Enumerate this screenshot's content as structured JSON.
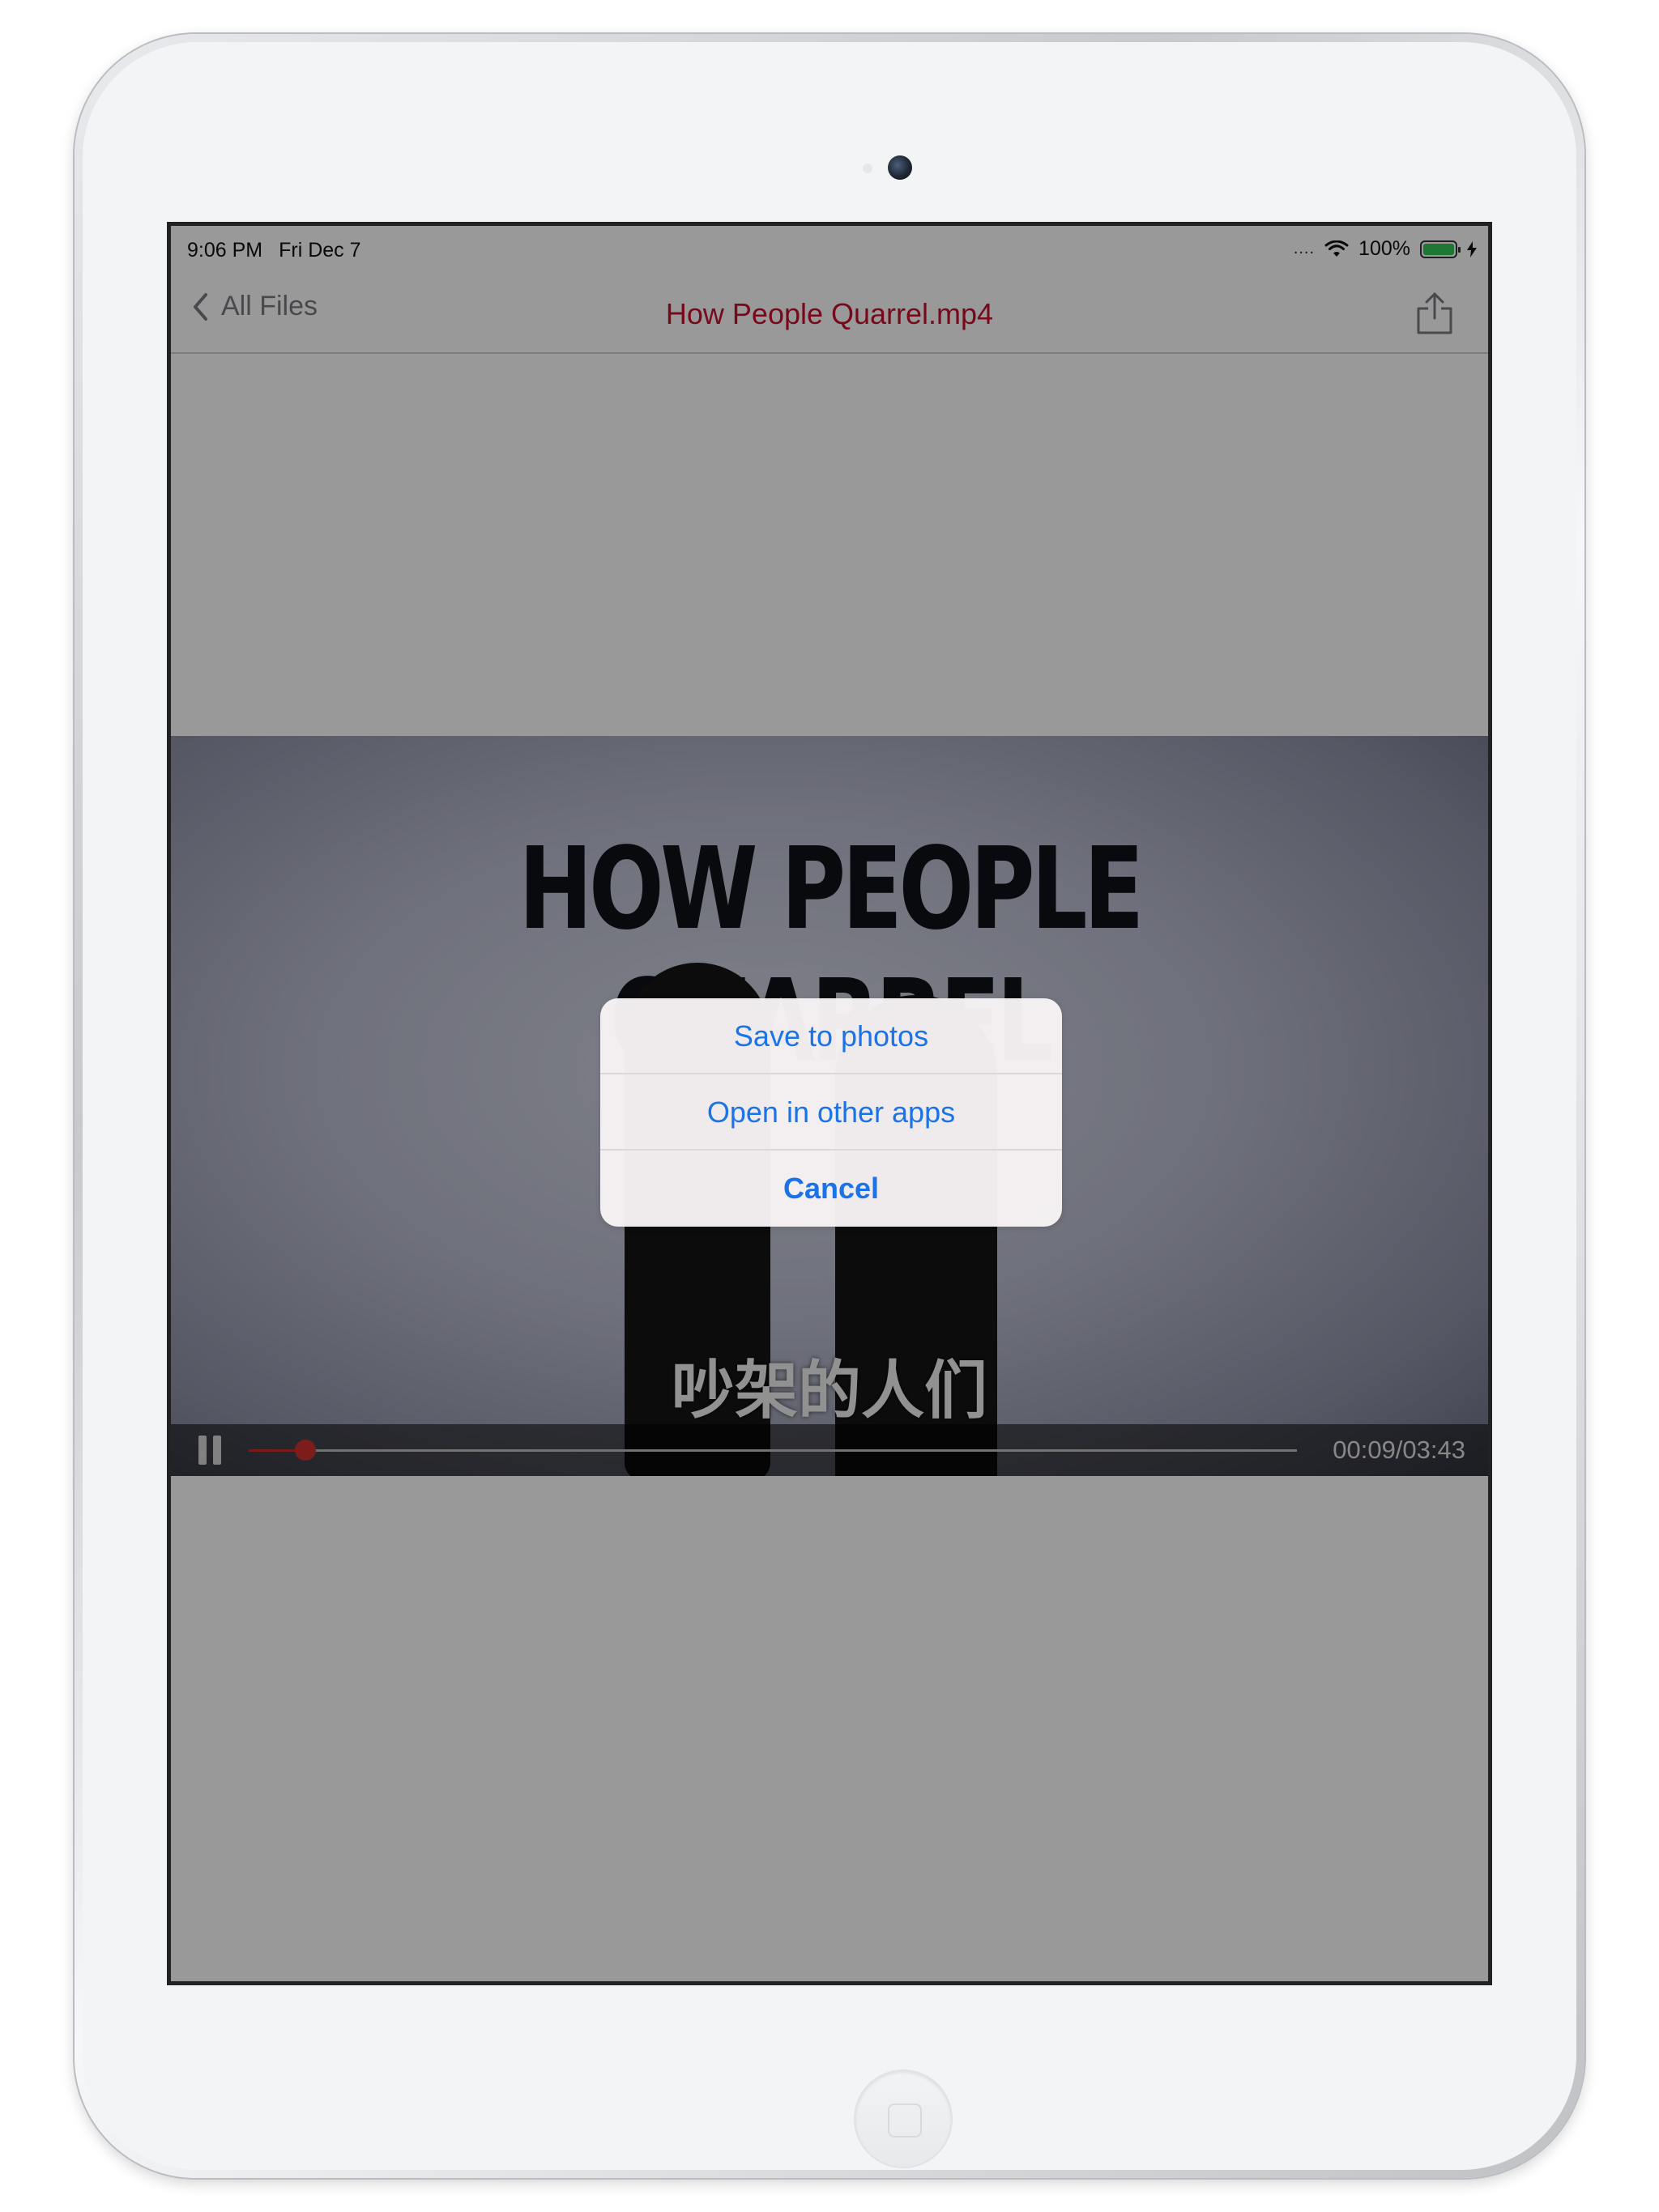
{
  "status_bar": {
    "time": "9:06 PM",
    "date": "Fri Dec 7",
    "signal": "....",
    "battery_percent": "100%",
    "battery_level": 1.0,
    "icons": [
      "wifi-icon",
      "battery-icon",
      "charging-icon"
    ]
  },
  "nav": {
    "back_label": "All Files",
    "title": "How People Quarrel.mp4",
    "share_icon": "share-icon",
    "title_color": "#c8102e"
  },
  "video": {
    "title_text": "HOW PEOPLE QUARREL",
    "subtitle_text": "吵架的人们",
    "time_display": "00:09/03:43",
    "progress_fraction": 0.054,
    "progress_color": "#d0312d"
  },
  "action_sheet": {
    "items": [
      {
        "label": "Save to photos"
      },
      {
        "label": "Open in other apps"
      },
      {
        "label": "Cancel"
      }
    ],
    "accent_color": "#1a73e8"
  }
}
